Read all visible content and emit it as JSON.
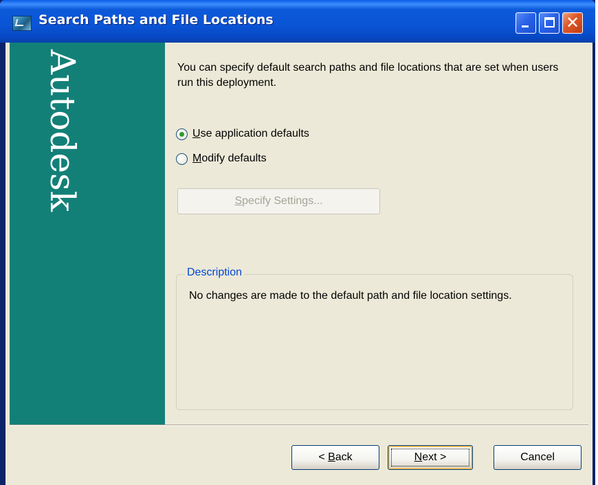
{
  "window": {
    "title": "Search Paths and File Locations",
    "icon": "autodesk-deployment-icon"
  },
  "titlebar_buttons": {
    "minimize": "minimize-icon",
    "maximize": "maximize-icon",
    "close": "close-icon"
  },
  "brand": {
    "text": "Autodesk",
    "panel_color": "#138078"
  },
  "intro_text": "You can specify default search paths and file locations that are set when users run this deployment.",
  "options": {
    "use_defaults": {
      "label_prefix": "U",
      "label_rest": "se application defaults",
      "checked": true
    },
    "modify_defaults": {
      "label_prefix": "M",
      "label_rest": "odify defaults",
      "checked": false
    }
  },
  "specify_button": {
    "label_prefix": "S",
    "label_rest": "pecify Settings...",
    "enabled": false
  },
  "description": {
    "legend": "Description",
    "text": "No changes are made to the default path and file location settings."
  },
  "footer": {
    "back": {
      "prefix": "< ",
      "mnemonic": "B",
      "rest": "ack"
    },
    "next": {
      "mnemonic": "N",
      "rest": "ext >"
    },
    "cancel": "Cancel"
  }
}
